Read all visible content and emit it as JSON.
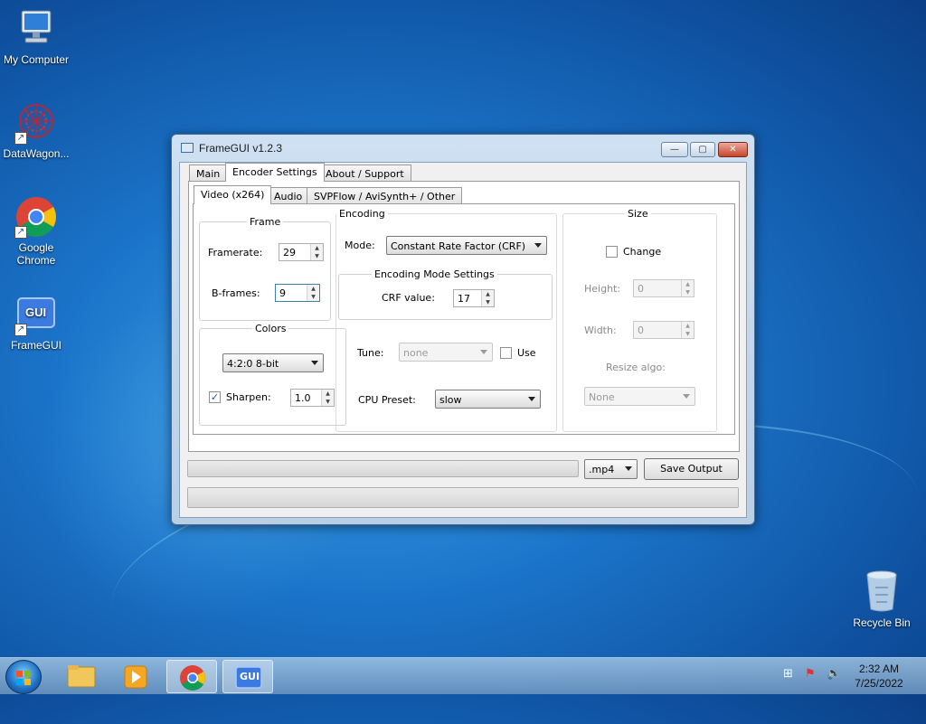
{
  "desktop": {
    "icons": [
      {
        "label": "My Computer"
      },
      {
        "label": "DataWagon..."
      },
      {
        "label": "Google Chrome"
      },
      {
        "label": "FrameGUI"
      }
    ],
    "recycle_bin": "Recycle Bin",
    "shortcut_glyph": "↗",
    "gui_badge": "GUI"
  },
  "window": {
    "title": "FrameGUI v1.2.3",
    "controls": {
      "minimize": "—",
      "maximize": "▢",
      "close": "✕"
    }
  },
  "tabs": [
    "Main",
    "Encoder Settings",
    "About / Support"
  ],
  "subtabs": [
    "Video (x264)",
    "Audio",
    "SVPFlow / AviSynth+ / Other"
  ],
  "frame_group": {
    "legend": "Frame",
    "framerate_label": "Framerate:",
    "framerate_value": "29",
    "bframes_label": "B-frames:",
    "bframes_value": "9"
  },
  "colors_group": {
    "legend": "Colors",
    "format_value": "4:2:0 8-bit",
    "sharpen_label": "Sharpen:",
    "sharpen_checked": true,
    "sharpen_value": "1.0"
  },
  "encoding_group": {
    "legend": "Encoding",
    "mode_label": "Mode:",
    "mode_value": "Constant Rate Factor (CRF)",
    "settings_legend": "Encoding Mode Settings",
    "crf_label": "CRF value:",
    "crf_value": "17",
    "tune_label": "Tune:",
    "tune_value": "none",
    "use_label": "Use",
    "cpu_label": "CPU Preset:",
    "cpu_value": "slow"
  },
  "size_group": {
    "legend": "Size",
    "change_label": "Change",
    "height_label": "Height:",
    "height_value": "0",
    "width_label": "Width:",
    "width_value": "0",
    "resize_label": "Resize algo:",
    "resize_value": "None"
  },
  "bottom": {
    "container_value": ".mp4",
    "save_label": "Save Output"
  },
  "spin_arrows": {
    "up": "▲",
    "down": "▼"
  },
  "check_mark": "✓",
  "taskbar": {
    "time": "2:32 AM",
    "date": "7/25/2022",
    "gui_badge": "GUI"
  },
  "colors": {
    "desktop_blue": "#1b74c9",
    "window_frame": "#b9cfe6",
    "accent": "#1a4fa0"
  }
}
